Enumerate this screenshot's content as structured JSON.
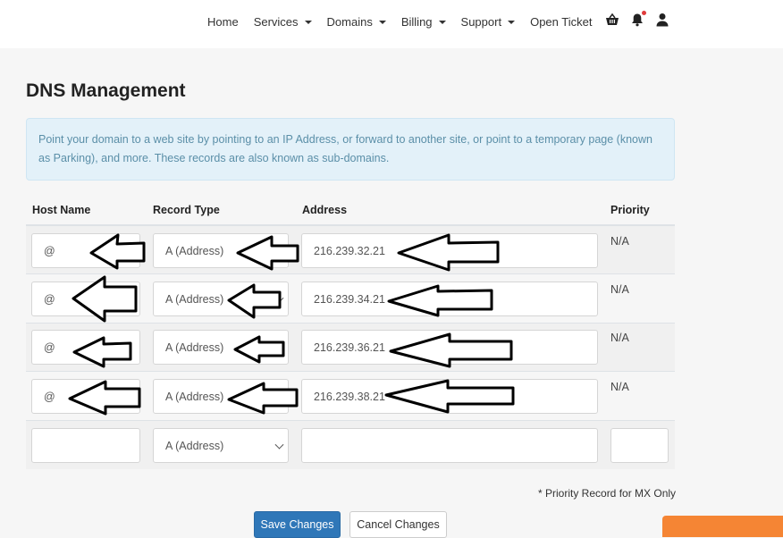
{
  "nav": {
    "items": [
      {
        "label": "Home",
        "dropdown": false
      },
      {
        "label": "Services",
        "dropdown": true
      },
      {
        "label": "Domains",
        "dropdown": true
      },
      {
        "label": "Billing",
        "dropdown": true
      },
      {
        "label": "Support",
        "dropdown": true
      },
      {
        "label": "Open Ticket",
        "dropdown": false
      }
    ],
    "icons": [
      "basket-icon",
      "bell-icon",
      "user-icon"
    ]
  },
  "page": {
    "title": "DNS Management",
    "info": "Point your domain to a web site by pointing to an IP Address, or forward to another site, or point to a temporary page (known as Parking), and more. These records are also known as sub-domains."
  },
  "table": {
    "columns": [
      "Host Name",
      "Record Type",
      "Address",
      "Priority"
    ],
    "rows": [
      {
        "host": "@",
        "type": "A (Address)",
        "address": "216.239.32.21",
        "priority": "N/A"
      },
      {
        "host": "@",
        "type": "A (Address)",
        "address": "216.239.34.21",
        "priority": "N/A"
      },
      {
        "host": "@",
        "type": "A (Address)",
        "address": "216.239.36.21",
        "priority": "N/A"
      },
      {
        "host": "@",
        "type": "A (Address)",
        "address": "216.239.38.21",
        "priority": "N/A"
      }
    ],
    "new_row": {
      "host": "",
      "type": "A (Address)",
      "address": "",
      "priority": ""
    }
  },
  "footnote": "* Priority Record for MX Only",
  "buttons": {
    "save": "Save Changes",
    "cancel": "Cancel Changes"
  },
  "colors": {
    "primary": "#2f77b8",
    "alert_bg": "#e3f1f9",
    "alert_text": "#5b8fa8",
    "chat_tab": "#f58534",
    "notification": "#e03b3b"
  }
}
